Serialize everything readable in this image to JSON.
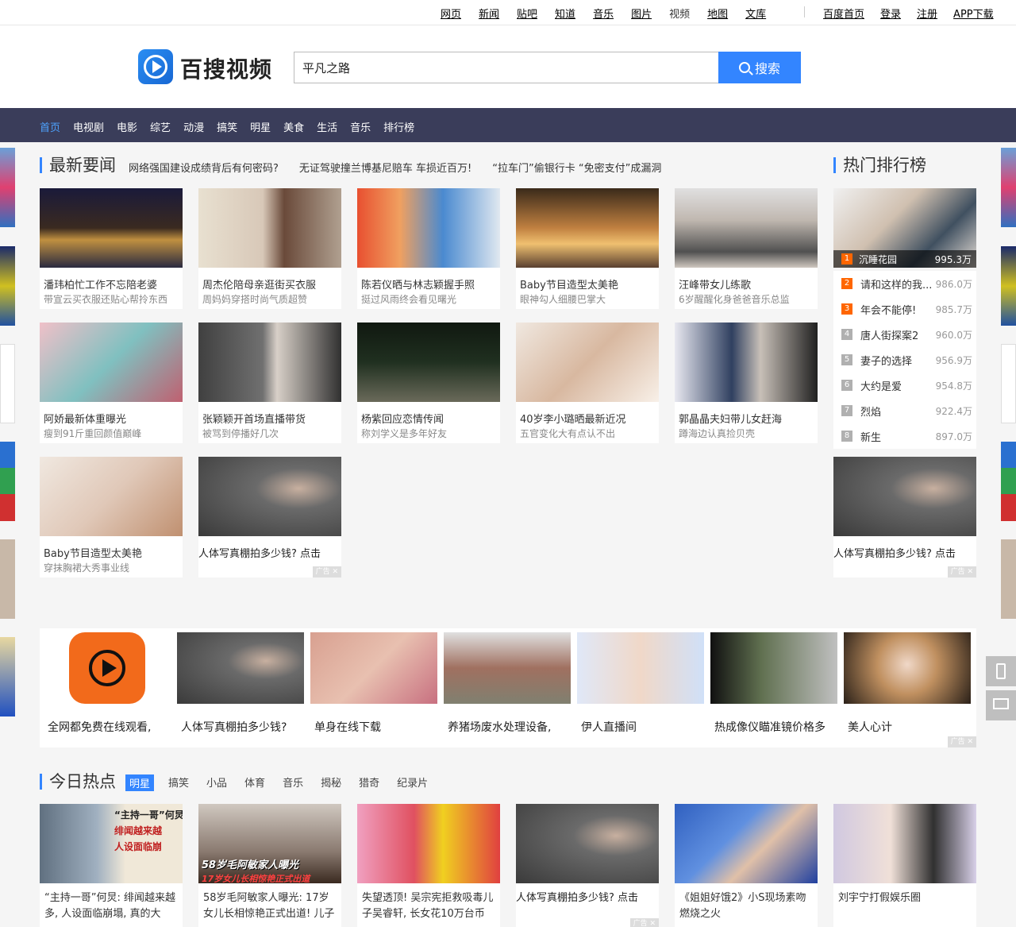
{
  "top_nav": {
    "links": [
      "网页",
      "新闻",
      "贴吧",
      "知道",
      "音乐",
      "图片",
      "视频",
      "地图",
      "文库"
    ],
    "current": "视频",
    "right_links": [
      "百度首页",
      "登录",
      "注册",
      "APP下载"
    ]
  },
  "header": {
    "logo_text": "百搜视频",
    "search_value": "平凡之路",
    "search_button": "搜索"
  },
  "channel_nav": {
    "items": [
      "首页",
      "电视剧",
      "电影",
      "综艺",
      "动漫",
      "搞笑",
      "明星",
      "美食",
      "生活",
      "音乐",
      "排行榜"
    ],
    "active": "首页"
  },
  "news": {
    "title": "最新要闻",
    "headlines": [
      "网络强国建设成绩背后有何密码?",
      "无证驾驶撞兰博基尼赔车 车损近百万!",
      "“拉车门”偷银行卡 “免密支付”成漏洞"
    ],
    "cards": [
      {
        "title": "潘玮柏忙工作不忘陪老婆",
        "subtitle": "带宣云买衣服还贴心帮拎东西"
      },
      {
        "title": "周杰伦陪母亲逛街买衣服",
        "subtitle": "周妈妈穿搭时尚气质超赞"
      },
      {
        "title": "陈若仪晒与林志颖握手照",
        "subtitle": "挺过风雨终会看见曙光"
      },
      {
        "title": "Baby节目造型太美艳",
        "subtitle": "眼神勾人细腰巴掌大"
      },
      {
        "title": "汪峰带女儿练歌",
        "subtitle": "6岁醒醒化身爸爸音乐总监"
      },
      {
        "title": "阿娇最新体重曝光",
        "subtitle": "瘦到91斤重回颜值巅峰"
      },
      {
        "title": "张颖颖开首场直播带货",
        "subtitle": "被骂到停播好几次"
      },
      {
        "title": "杨紫回应恋情传闻",
        "subtitle": "称刘学义是多年好友"
      },
      {
        "title": "40岁李小璐晒最新近况",
        "subtitle": "五官变化大有点认不出"
      },
      {
        "title": "郭晶晶夫妇带儿女赶海",
        "subtitle": "蹲海边认真捡贝壳"
      },
      {
        "title": "Baby节目造型太美艳",
        "subtitle": "穿抹胸裙大秀事业线"
      }
    ],
    "ad_card": {
      "title": "人体写真棚拍多少钱? 点击",
      "tag": "广告"
    }
  },
  "ranking": {
    "title": "热门排行榜",
    "items": [
      {
        "rank": "1",
        "name": "沉睡花园",
        "count": "995.3万"
      },
      {
        "rank": "2",
        "name": "请和这样的我...",
        "count": "986.0万"
      },
      {
        "rank": "3",
        "name": "年会不能停!",
        "count": "985.7万"
      },
      {
        "rank": "4",
        "name": "唐人街探案2",
        "count": "960.0万"
      },
      {
        "rank": "5",
        "name": "妻子的选择",
        "count": "956.9万"
      },
      {
        "rank": "6",
        "name": "大约是爱",
        "count": "954.8万"
      },
      {
        "rank": "7",
        "name": "烈焰",
        "count": "922.4万"
      },
      {
        "rank": "8",
        "name": "新生",
        "count": "897.0万"
      }
    ],
    "ad_card": {
      "title": "人体写真棚拍多少钱? 点击",
      "tag": "广告"
    }
  },
  "ad_row": {
    "items": [
      "全网都免费在线观看,",
      "人体写真棚拍多少钱?",
      "单身在线下载",
      "养猪场废水处理设备,",
      "伊人直播间",
      "热成像仪瞄准镜价格多",
      "美人心计"
    ],
    "tag": "广告"
  },
  "hot_today": {
    "title": "今日热点",
    "tabs": [
      "明星",
      "搞笑",
      "小品",
      "体育",
      "音乐",
      "揭秘",
      "猎奇",
      "纪录片"
    ],
    "active_tab": "明星",
    "cards": [
      {
        "text": "“主持一哥”何炅: 绯闻越来越多, 人设面临崩塌, 真的大"
      },
      {
        "text": "58岁毛阿敏家人曝光: 17岁女儿长相惊艳正式出道! 儿子"
      },
      {
        "text": "失望透顶! 吴宗宪拒救吸毒儿子吴睿轩, 长女花10万台币"
      },
      {
        "text": "人体写真棚拍多少钱? 点击",
        "ad": true
      },
      {
        "text": "《姐姐好饿2》小S现场素吻燃烧之火"
      },
      {
        "text": "刘宇宁打假娱乐圈"
      }
    ],
    "overlay_texts": [
      "“主持一哥”何炅",
      "绯闻越来越",
      "人设面临崩",
      "58岁毛阿敏家人曝光",
      "17岁女儿长相惊艳正式出道"
    ]
  },
  "colors": {
    "accent": "#3385ff",
    "nav_bg": "#3a3d5a",
    "rank_top": "#ff6600",
    "rank_other": "#b0b0b0"
  }
}
